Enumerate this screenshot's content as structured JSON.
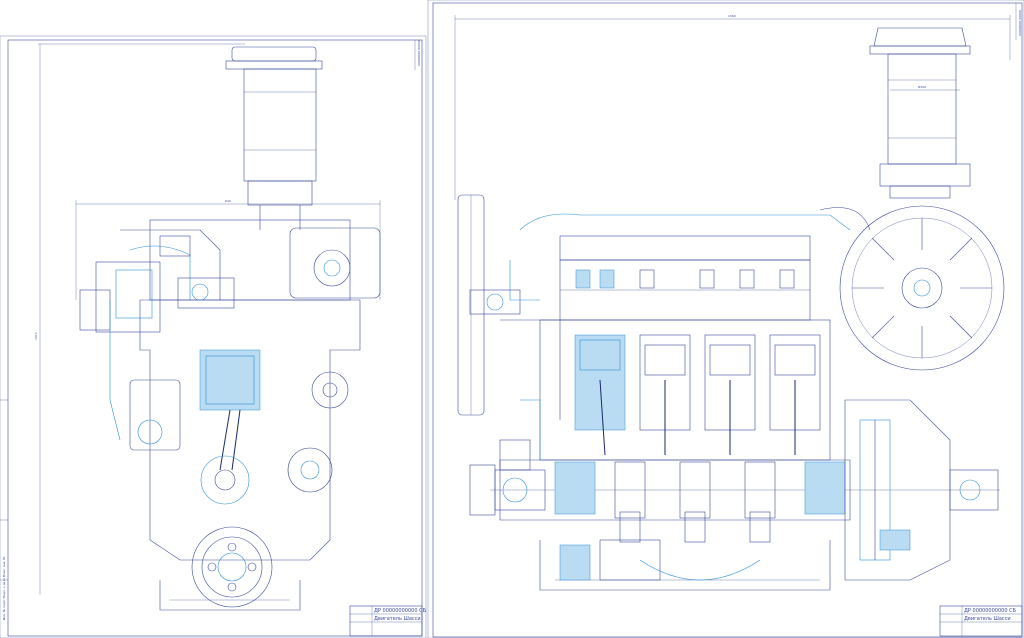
{
  "drawing": {
    "colors": {
      "line": "#3a4a9a",
      "accent": "#2f8fd8",
      "paper": "#ffffff"
    },
    "sheets": [
      {
        "view": "front",
        "title_block": {
          "designation": "ДР 00000000000 СБ",
          "title": "Двигатель Шасси"
        },
        "side_stamp": "00000000 00000",
        "left_stamp": "Инв. № подл.   Подп. и дата   Взам. инв. №",
        "dim_width": "640",
        "dim_height": "1015"
      },
      {
        "view": "section",
        "title_block": {
          "designation": "ДР 00000000000 СБ",
          "title": "Двигатель Шасси"
        },
        "side_stamp": "00000000 00000",
        "dim_length": "1360",
        "dim_filter": "Ø320"
      }
    ]
  }
}
